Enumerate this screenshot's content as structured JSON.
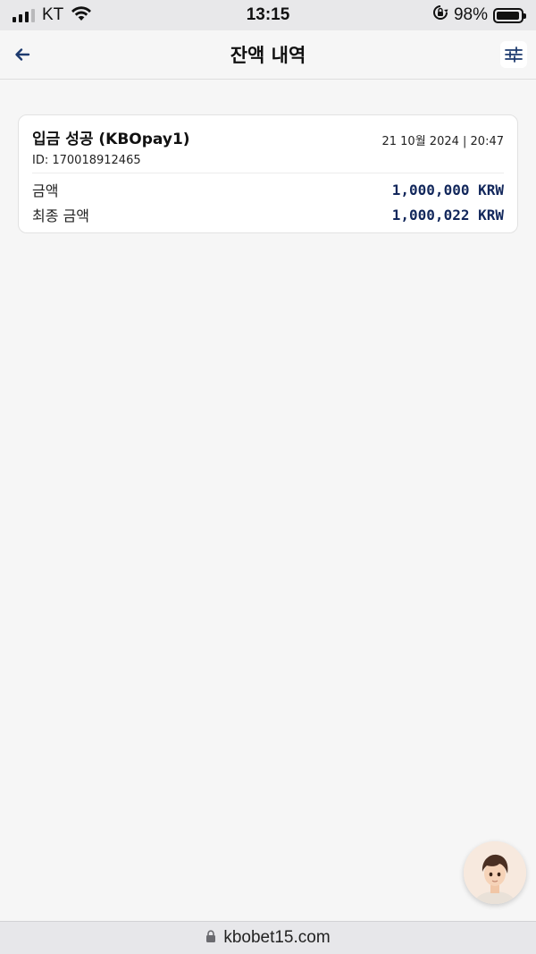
{
  "status_bar": {
    "carrier": "KT",
    "time": "13:15",
    "battery_percent": "98%",
    "battery_level": 0.98,
    "icons": [
      "signal-icon",
      "wifi-icon",
      "rotation-lock-icon",
      "battery-icon"
    ]
  },
  "header": {
    "title": "잔액 내역",
    "back_icon": "arrow-left-icon",
    "filter_icon": "sliders-icon",
    "accent_color": "#1d3a6e"
  },
  "transaction": {
    "title": "입금 성공 (KBOpay1)",
    "datetime": "21 10월 2024 | 20:47",
    "id_text": "ID: 170018912465",
    "rows": [
      {
        "label": "금액",
        "value": "1,000,000 KRW"
      },
      {
        "label": "최종 금액",
        "value": "1,000,022 KRW"
      }
    ],
    "value_color": "#13285c"
  },
  "chat": {
    "icon": "avatar-icon"
  },
  "browser": {
    "url": "kbobet15.com",
    "lock_icon": "lock-icon"
  }
}
